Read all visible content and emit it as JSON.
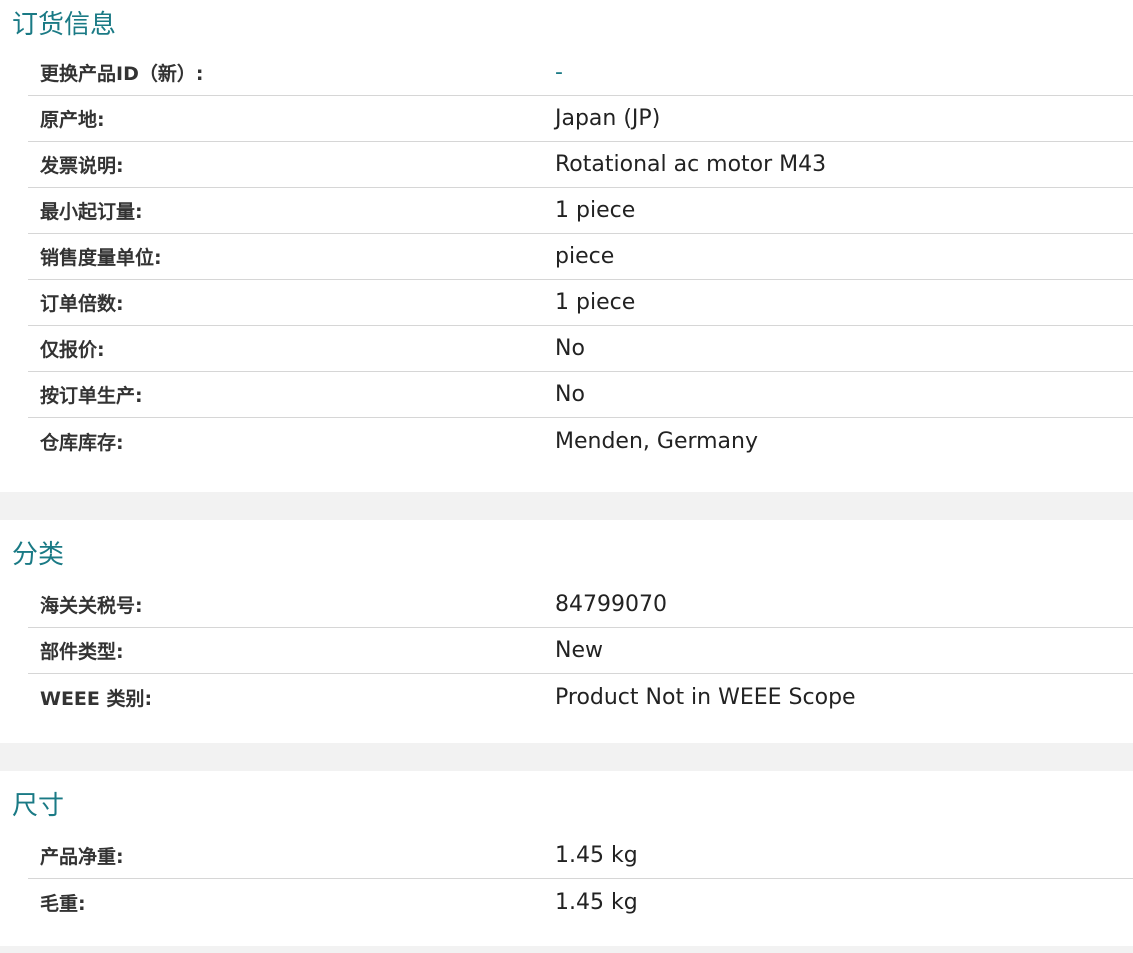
{
  "sections": [
    {
      "title": "订货信息",
      "rows": [
        {
          "label": "更换产品ID（新）:",
          "value": "-"
        },
        {
          "label": "原产地:",
          "value": "Japan (JP)"
        },
        {
          "label": "发票说明:",
          "value": "Rotational ac motor M43"
        },
        {
          "label": "最小起订量:",
          "value": "1 piece"
        },
        {
          "label": "销售度量单位:",
          "value": "piece"
        },
        {
          "label": "订单倍数:",
          "value": "1 piece"
        },
        {
          "label": "仅报价:",
          "value": "No"
        },
        {
          "label": "按订单生产:",
          "value": "No"
        },
        {
          "label": "仓库库存:",
          "value": "Menden, Germany"
        }
      ]
    },
    {
      "title": "分类",
      "rows": [
        {
          "label": "海关关税号:",
          "value": "84799070"
        },
        {
          "label": "部件类型:",
          "value": "New"
        },
        {
          "label": "WEEE 类别:",
          "value": "Product Not in WEEE Scope"
        }
      ]
    },
    {
      "title": "尺寸",
      "rows": [
        {
          "label": "产品净重:",
          "value": "1.45 kg"
        },
        {
          "label": "毛重:",
          "value": "1.45 kg"
        }
      ]
    }
  ],
  "colors": {
    "title": "#1a7a85",
    "separator": "#d6d6d6",
    "gap_background": "#f2f2f2"
  }
}
